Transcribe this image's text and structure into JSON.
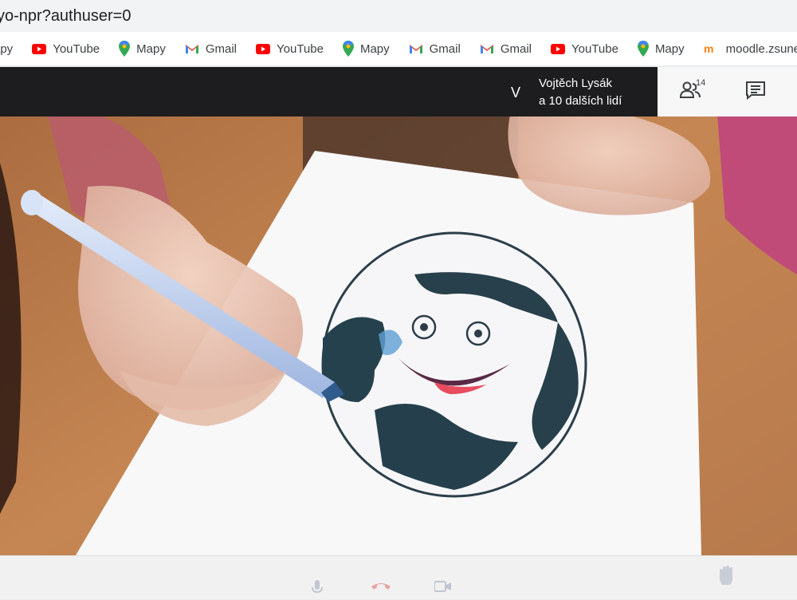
{
  "browser": {
    "url": "yo-npr?authuser=0"
  },
  "bookmarks": [
    {
      "label": "apy",
      "icon": "maps-icon"
    },
    {
      "label": "YouTube",
      "icon": "youtube-icon"
    },
    {
      "label": "Mapy",
      "icon": "maps-icon"
    },
    {
      "label": "Gmail",
      "icon": "gmail-icon"
    },
    {
      "label": "YouTube",
      "icon": "youtube-icon"
    },
    {
      "label": "Mapy",
      "icon": "maps-icon"
    },
    {
      "label": "Gmail",
      "icon": "gmail-icon"
    },
    {
      "label": "Gmail",
      "icon": "gmail-icon"
    },
    {
      "label": "YouTube",
      "icon": "youtube-icon"
    },
    {
      "label": "Mapy",
      "icon": "maps-icon"
    },
    {
      "label": "moodle.zsunesco",
      "icon": "moodle-icon"
    }
  ],
  "meet": {
    "presenter_initial": "V",
    "presenter_line1": "Vojtěch Lysák",
    "presenter_line2": "a 10 dalších lidí",
    "participants_count": "14"
  },
  "colors": {
    "youtube": "#ff0000",
    "gmail_red": "#ea4335",
    "maps_green": "#34a853",
    "dark_bar": "#1d1d1f"
  }
}
